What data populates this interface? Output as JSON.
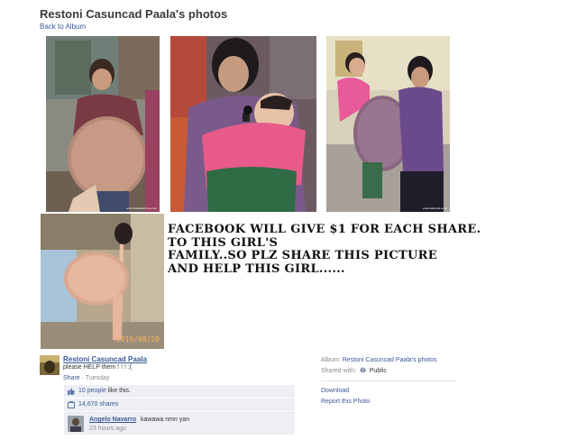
{
  "header": {
    "title": "Restoni Casuncad Paala's photos",
    "back_link": "Back to Album"
  },
  "photos": {
    "photo1_watermark": "www.hindustantimes.com",
    "photo3_watermark": "www.dailymail.co.uk",
    "photo4_datestamp": "2010/08/28"
  },
  "caption": {
    "line1": "FACEBOOK WILL GIVE  $1 FOR EACH SHARE.",
    "line2": "TO THIS GIRL'S",
    "line3": "FAMILY..SO PLZ SHARE THIS PICTURE",
    "line4": "AND HELP THIS GIRL......"
  },
  "post": {
    "author": "Restoni Casuncad Paala",
    "text": "please HELP them ! ! ! :(",
    "share": "Share",
    "separator": " · ",
    "date": "Tuesday"
  },
  "ufi": {
    "likes_count": "10 people",
    "likes_suffix": " like this.",
    "shares": "14,670 shares"
  },
  "comment": {
    "author": "Angelo Navarro",
    "text": "kawawa nmn yan",
    "time": "23 hours ago"
  },
  "side": {
    "album_label": "Album:",
    "album_value": "Restoni Casuncad Paala's photos",
    "shared_label": "Shared with:",
    "shared_value": "Public",
    "download": "Download",
    "report": "Report this Photo"
  },
  "icons": {
    "like": "thumbs-up-icon",
    "share": "share-icon",
    "privacy": "globe-icon"
  },
  "colors": {
    "link": "#3b5998",
    "ufi_bg": "#edeff4"
  }
}
